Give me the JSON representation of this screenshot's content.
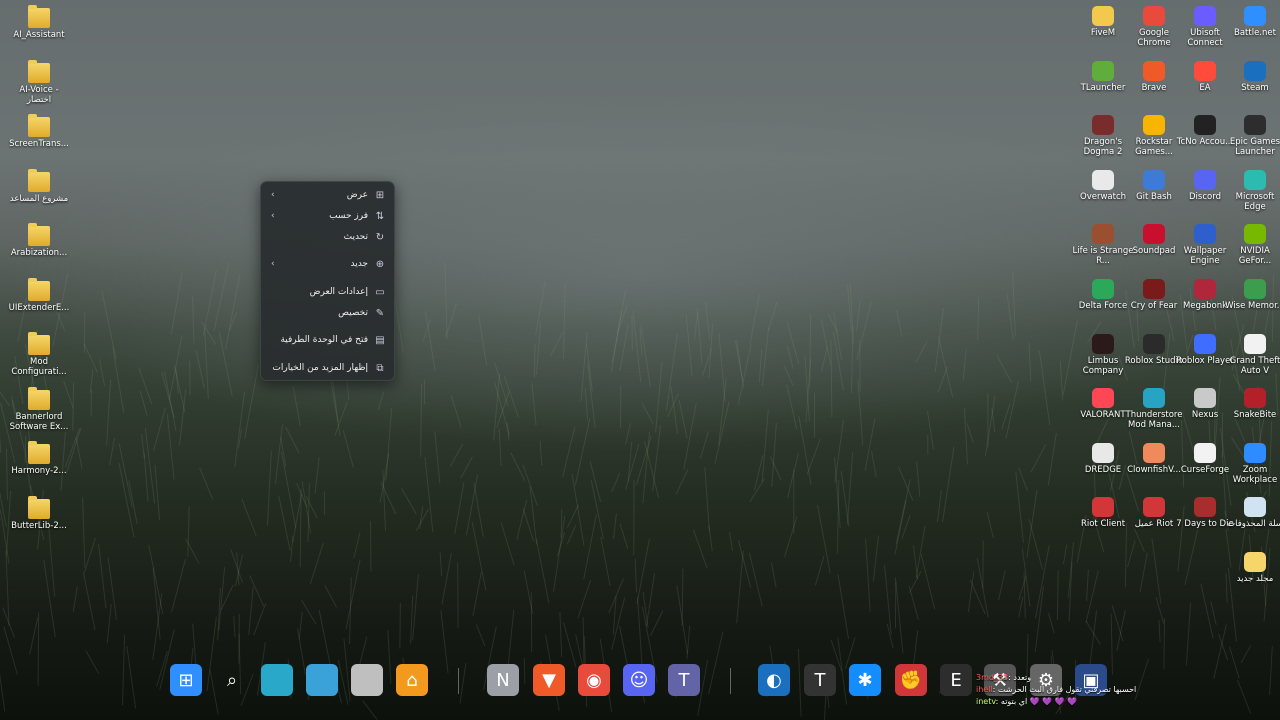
{
  "left_icons": [
    {
      "label": "AI_Assistant",
      "type": "folder"
    },
    {
      "label": "AI-Voice - اختصار",
      "type": "folder"
    },
    {
      "label": "ScreenTrans...",
      "type": "folder"
    },
    {
      "label": "مشروع المساعد",
      "type": "folder"
    },
    {
      "label": "Arabization...",
      "type": "folder"
    },
    {
      "label": "UIExtenderE...",
      "type": "folder"
    },
    {
      "label": "Mod Configurati...",
      "type": "folder"
    },
    {
      "label": "Bannerlord Software Ex...",
      "type": "folder"
    },
    {
      "label": "Harmony-2...",
      "type": "folder"
    },
    {
      "label": "ButterLib-2...",
      "type": "folder"
    }
  ],
  "right_icons": [
    [
      "FiveM",
      "Google Chrome",
      "Ubisoft Connect",
      "Battle.net"
    ],
    [
      "TLauncher",
      "Brave",
      "EA",
      "Steam"
    ],
    [
      "Dragon's Dogma 2",
      "Rockstar Games...",
      "TcNo Accou...",
      "Epic Games Launcher"
    ],
    [
      "Overwatch",
      "Git Bash",
      "Discord",
      "Microsoft Edge"
    ],
    [
      "Life is Strange R...",
      "Soundpad",
      "Wallpaper Engine",
      "NVIDIA GeFor..."
    ],
    [
      "Delta Force",
      "Cry of Fear",
      "Megabonk",
      "Wise Memor..."
    ],
    [
      "Limbus Company",
      "Roblox Studio",
      "Roblox Player",
      "Grand Theft Auto V"
    ],
    [
      "VALORANT",
      "Thunderstore Mod Mana...",
      "Nexus",
      "SnakeBite"
    ],
    [
      "DREDGE",
      "ClownfishV...",
      "CurseForge",
      "Zoom Workplace"
    ],
    [
      "Riot Client",
      "عميل Riot",
      "7 Days to Die",
      "سلة المحذوفات"
    ],
    [
      "",
      "",
      "",
      "مجلد جديد"
    ]
  ],
  "right_icon_colors": [
    [
      "#f2c94c",
      "#e84b3c",
      "#6a5cff",
      "#2f8fff"
    ],
    [
      "#5fae3c",
      "#f05a28",
      "#ff4b3a",
      "#1b6fbf"
    ],
    [
      "#7a2c2c",
      "#f7b500",
      "#222222",
      "#2d2d2d"
    ],
    [
      "#e9e9e9",
      "#3d7bd6",
      "#5865f2",
      "#2bbbb0"
    ],
    [
      "#9a5030",
      "#c8102e",
      "#2f5fcc",
      "#76b900"
    ],
    [
      "#2ba85a",
      "#7a1b1b",
      "#b0263b",
      "#3b9d4d"
    ],
    [
      "#2a1a1a",
      "#2b2b2b",
      "#3e6dff",
      "#f2f2f2"
    ],
    [
      "#ff4655",
      "#27a3c3",
      "#c9c9c9",
      "#b3202a"
    ],
    [
      "#e8e8e8",
      "#f08a5d",
      "#f2f2f2",
      "#2d8cff"
    ],
    [
      "#d13639",
      "#d13639",
      "#a82d2d",
      "#cfe3f2"
    ],
    [
      "",
      "",
      "",
      "#f6d66a"
    ]
  ],
  "context_menu": {
    "items": [
      {
        "label": "عرض",
        "icon": "grid-icon",
        "glyph": "⊞",
        "submenu": true
      },
      {
        "label": "فرز حسب",
        "icon": "sort-icon",
        "glyph": "⇅",
        "submenu": true
      },
      {
        "label": "تحديث",
        "icon": "refresh-icon",
        "glyph": "↻",
        "submenu": false
      },
      {
        "label": "جديد",
        "icon": "new-icon",
        "glyph": "⊕",
        "submenu": true
      },
      {
        "label": "إعدادات العرض",
        "icon": "display-icon",
        "glyph": "▭",
        "submenu": false
      },
      {
        "label": "تخصيص",
        "icon": "brush-icon",
        "glyph": "✎",
        "submenu": false
      },
      {
        "label": "فتح في الوحدة الطرفية",
        "icon": "terminal-icon",
        "glyph": "▤",
        "submenu": false
      },
      {
        "label": "إظهار المزيد من الخيارات",
        "icon": "more-options-icon",
        "glyph": "⧉",
        "submenu": false
      }
    ],
    "chevron": "‹"
  },
  "taskbar": {
    "items": [
      {
        "name": "start",
        "color": "#2f8fff",
        "glyph": "⊞"
      },
      {
        "name": "search",
        "color": "transparent",
        "glyph": "⌕"
      },
      {
        "name": "task-view",
        "color": "#2aa8c9",
        "glyph": ""
      },
      {
        "name": "explorer-window",
        "color": "#3aa2d8",
        "glyph": ""
      },
      {
        "name": "capsule",
        "color": "#bfbfbf",
        "glyph": ""
      },
      {
        "name": "home",
        "color": "#f39a1e",
        "glyph": "⌂"
      },
      {
        "name": "nexus",
        "color": "#9aa0a6",
        "glyph": "N"
      },
      {
        "name": "brave",
        "color": "#f05a28",
        "glyph": "▼"
      },
      {
        "name": "chrome",
        "color": "#e84b3c",
        "glyph": "◉"
      },
      {
        "name": "discord",
        "color": "#5865f2",
        "glyph": "☺"
      },
      {
        "name": "teams",
        "color": "#6264a7",
        "glyph": "T"
      },
      {
        "name": "steam",
        "color": "#1b6fbf",
        "glyph": "◐"
      },
      {
        "name": "tcno",
        "color": "#333333",
        "glyph": "T"
      },
      {
        "name": "battlenet",
        "color": "#148eff",
        "glyph": "✱"
      },
      {
        "name": "riot",
        "color": "#d13639",
        "glyph": "✊"
      },
      {
        "name": "epic",
        "color": "#2d2d2d",
        "glyph": "E"
      },
      {
        "name": "tool",
        "color": "#555555",
        "glyph": "⚒"
      },
      {
        "name": "settings",
        "color": "#666666",
        "glyph": "⚙"
      },
      {
        "name": "capture",
        "color": "#2a4a8a",
        "glyph": "▣"
      }
    ]
  },
  "chat_overlay": {
    "lines": [
      {
        "user": "3md_33",
        "text": ": وتعدد",
        "user_color": "#ff5a5a"
      },
      {
        "user": "ihell",
        "text": ": احسبها تصرفني تقول فارق البث الحرشت",
        "user_color": "#ff5a5a"
      },
      {
        "user": "inetv",
        "text": ": اي بتوته 💜 💜 💜 💜",
        "user_color": "#c9ff6a"
      }
    ]
  }
}
